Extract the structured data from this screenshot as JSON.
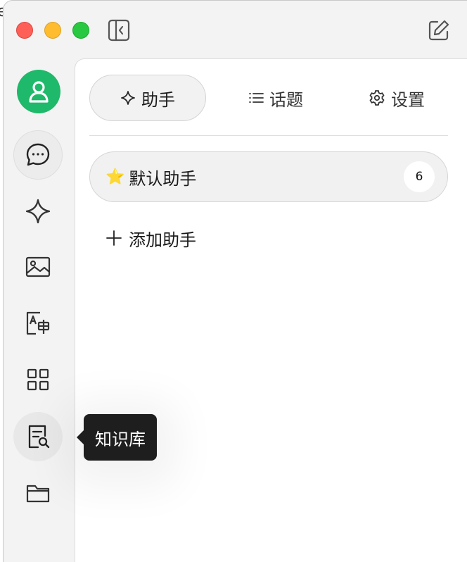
{
  "window": {
    "traffic_lights": [
      "close",
      "minimize",
      "zoom"
    ],
    "colors": {
      "close": "#fe5f57",
      "minimize": "#febc2e",
      "zoom": "#28c840",
      "avatar": "#1eb96a"
    }
  },
  "titlebar": {
    "left_icon": "sidebar-toggle-icon",
    "right_icon": "new-note-icon"
  },
  "rail": {
    "items": [
      {
        "name": "avatar",
        "icon": "user-icon"
      },
      {
        "name": "chat",
        "icon": "chat-bubble-icon",
        "active": true
      },
      {
        "name": "agents",
        "icon": "sparkle-icon"
      },
      {
        "name": "paintings",
        "icon": "image-icon"
      },
      {
        "name": "translate",
        "icon": "translate-icon"
      },
      {
        "name": "apps",
        "icon": "grid-icon"
      },
      {
        "name": "knowledge",
        "icon": "knowledge-search-icon",
        "hovered": true
      },
      {
        "name": "files",
        "icon": "folder-icon"
      }
    ],
    "tooltip": "知识库"
  },
  "tabs": [
    {
      "label": "助手",
      "icon": "sparkle-icon",
      "active": true
    },
    {
      "label": "话题",
      "icon": "list-icon"
    },
    {
      "label": "设置",
      "icon": "gear-icon"
    }
  ],
  "assistants": [
    {
      "emoji": "⭐️",
      "name": "默认助手",
      "count": "6"
    }
  ],
  "add_assistant_label": "添加助手"
}
